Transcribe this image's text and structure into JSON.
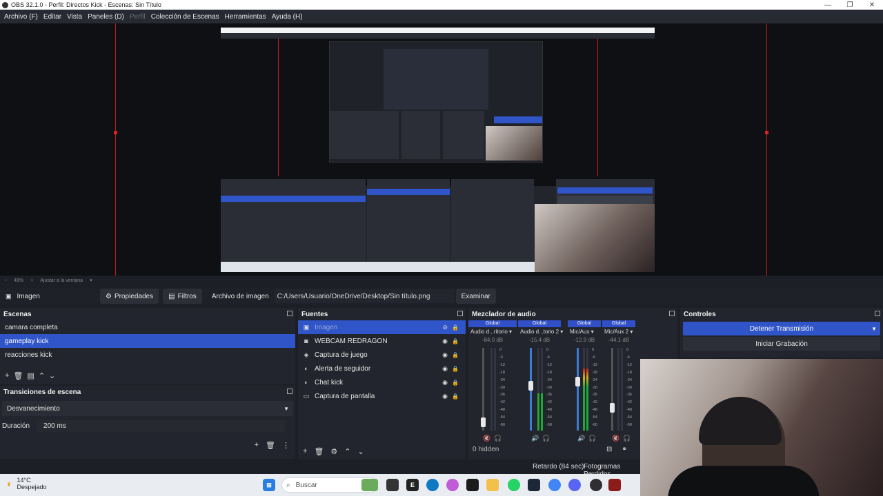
{
  "window": {
    "title": "OBS 32.1.0 - Perfil: Directos Kick - Escenas: Sin Título",
    "controls": [
      "—",
      "❐",
      "✕"
    ]
  },
  "menu": [
    {
      "label": "Archivo (F)",
      "enabled": true
    },
    {
      "label": "Editar",
      "enabled": true
    },
    {
      "label": "Vista",
      "enabled": true
    },
    {
      "label": "Paneles (D)",
      "enabled": true
    },
    {
      "label": "Perfil",
      "enabled": false
    },
    {
      "label": "Colección de Escenas",
      "enabled": true
    },
    {
      "label": "Herramientas",
      "enabled": true
    },
    {
      "label": "Ayuda (H)",
      "enabled": true
    }
  ],
  "preview_status": {
    "zoom": "49%",
    "fit_label": "Ajustar a la ventana"
  },
  "toolbar": {
    "source_name": "Imagen",
    "properties_label": "Propiedades",
    "filters_label": "Filtros",
    "image_file_label": "Archivo de imagen",
    "path_value": "C:/Users/Usuario/OneDrive/Desktop/Sin título.png",
    "browse_label": "Examinar"
  },
  "scenes": {
    "title": "Escenas",
    "items": [
      {
        "label": "camara completa",
        "selected": false
      },
      {
        "label": "gameplay kick",
        "selected": true
      },
      {
        "label": "reacciones kick",
        "selected": false
      }
    ]
  },
  "transitions": {
    "title": "Transiciones de escena",
    "selected": "Desvanecimiento",
    "duration_label": "Duración",
    "duration_value": "200 ms"
  },
  "sources": {
    "title": "Fuentes",
    "items": [
      {
        "label": "Imagen",
        "icon": "image-icon",
        "selected": true
      },
      {
        "label": "WEBCAM REDRAGON",
        "icon": "camera-icon",
        "selected": false
      },
      {
        "label": "Captura de juego",
        "icon": "gamepad-icon",
        "selected": false
      },
      {
        "label": "Alerta de seguidor",
        "icon": "globe-icon",
        "selected": false
      },
      {
        "label": "Chat kick",
        "icon": "globe-icon",
        "selected": false
      },
      {
        "label": "Captura de pantalla",
        "icon": "monitor-icon",
        "selected": false
      }
    ]
  },
  "mixer": {
    "title": "Mezclador de audio",
    "hidden_label": "0 hidden",
    "scale": [
      "0",
      "-6",
      "-12",
      "-18",
      "-24",
      "-30",
      "-36",
      "-42",
      "-48",
      "-54",
      "-60"
    ],
    "channels": [
      {
        "scope": "Global",
        "name": "Audio d...ritorio",
        "db": "-84.0 dB",
        "level": 0.0,
        "volume": 0.05,
        "muted": true
      },
      {
        "scope": "Global",
        "name": "Audio d...torio 2",
        "db": "-15.4 dB",
        "level": 0.45,
        "volume": 0.55,
        "muted": false
      },
      {
        "scope": "Global",
        "name": "Mic/Aux",
        "db": "-12.9 dB",
        "level": 0.75,
        "volume": 0.6,
        "muted": false
      },
      {
        "scope": "Global",
        "name": "Mic/Aux 2",
        "db": "-44.1 dB",
        "level": 0.0,
        "volume": 0.25,
        "muted": true
      }
    ]
  },
  "controls": {
    "title": "Controles",
    "stop_stream_label": "Detener Transmisión",
    "start_recording_label": "Iniciar Grabación"
  },
  "status": {
    "delay": "Retardo (84 sec)",
    "dropped_frames": "Fotogramas Perdidos"
  },
  "taskbar": {
    "temperature": "14°C",
    "weather": "Despejado",
    "search_placeholder": "Buscar"
  },
  "colors": {
    "accent": "#2f55c8",
    "bg": "#22252d",
    "preview_bounds": "#cc1a1a",
    "meter_green": "#1fa83c"
  }
}
